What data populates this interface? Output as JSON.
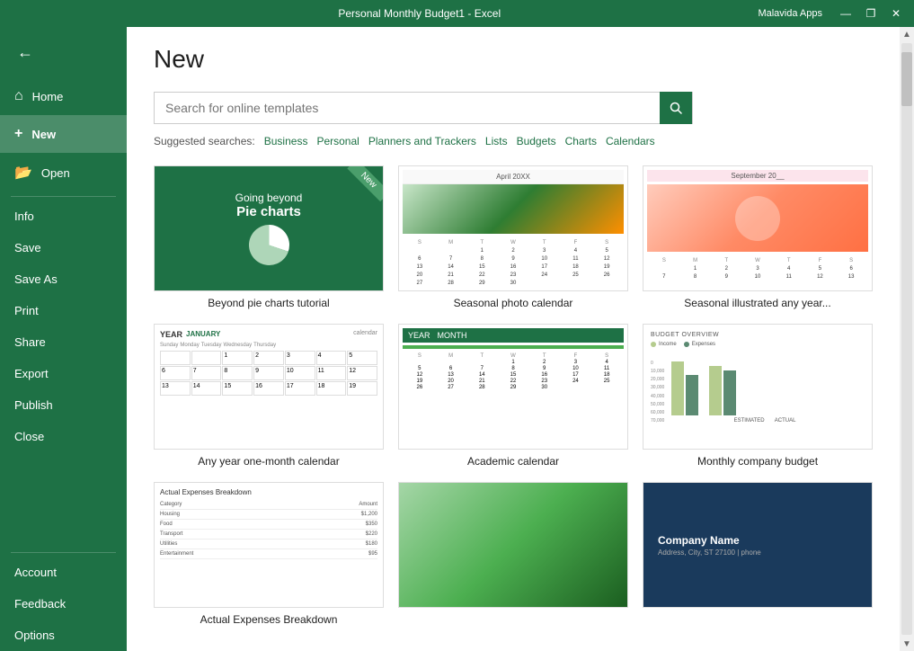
{
  "titlebar": {
    "title": "Personal Monthly Budget1  -  Excel",
    "app": "Malavida Apps",
    "minimize": "—",
    "maximize": "❐",
    "close": "✕"
  },
  "sidebar": {
    "back_icon": "←",
    "nav_items": [
      {
        "id": "home",
        "label": "Home",
        "icon": "⌂"
      },
      {
        "id": "new",
        "label": "New",
        "icon": "+"
      }
    ],
    "open_item": {
      "id": "open",
      "label": "Open",
      "icon": "📂"
    },
    "section_items": [
      {
        "id": "info",
        "label": "Info"
      },
      {
        "id": "save",
        "label": "Save"
      },
      {
        "id": "save-as",
        "label": "Save As"
      },
      {
        "id": "print",
        "label": "Print"
      },
      {
        "id": "share",
        "label": "Share"
      },
      {
        "id": "export",
        "label": "Export"
      },
      {
        "id": "publish",
        "label": "Publish"
      },
      {
        "id": "close",
        "label": "Close"
      }
    ],
    "bottom_items": [
      {
        "id": "account",
        "label": "Account"
      },
      {
        "id": "feedback",
        "label": "Feedback"
      },
      {
        "id": "options",
        "label": "Options"
      }
    ]
  },
  "main": {
    "title": "New",
    "search": {
      "placeholder": "Search for online templates",
      "button_icon": "🔍"
    },
    "suggested_label": "Suggested searches:",
    "suggested_tags": [
      "Business",
      "Personal",
      "Planners and Trackers",
      "Lists",
      "Budgets",
      "Charts",
      "Calendars"
    ],
    "templates": [
      {
        "id": "pie-charts-tutorial",
        "name": "Beyond pie charts tutorial",
        "type": "pie-charts",
        "is_new": true
      },
      {
        "id": "seasonal-photo-calendar",
        "name": "Seasonal photo calendar",
        "type": "photo-calendar"
      },
      {
        "id": "seasonal-illustrated",
        "name": "Seasonal illustrated any year...",
        "type": "illustrated-calendar"
      },
      {
        "id": "any-year-calendar",
        "name": "Any year one-month calendar",
        "type": "year-calendar"
      },
      {
        "id": "academic-calendar",
        "name": "Academic calendar",
        "type": "academic-calendar"
      },
      {
        "id": "monthly-company-budget",
        "name": "Monthly company budget",
        "type": "budget"
      },
      {
        "id": "actual-expenses",
        "name": "Actual Expenses Breakdown",
        "type": "expenses"
      },
      {
        "id": "green-abstract",
        "name": "",
        "type": "green-abstract"
      },
      {
        "id": "company-card",
        "name": "",
        "type": "company-card",
        "company_name": "Company Name",
        "company_sub": "Address, City, ST 27100  |  phone"
      }
    ],
    "bar_chart": {
      "y_ticks": [
        "70,000",
        "60,000",
        "50,000",
        "40,000",
        "30,000",
        "20,000",
        "10,000",
        "0"
      ],
      "groups": [
        {
          "label": "ESTIMATED",
          "bar1": {
            "color": "#b5cc8e",
            "height": 60
          },
          "bar2": {
            "color": "#5b8a72",
            "height": 45
          }
        },
        {
          "label": "ACTUAL",
          "bar1": {
            "color": "#b5cc8e",
            "height": 55
          },
          "bar2": {
            "color": "#5b8a72",
            "height": 50
          }
        }
      ],
      "legend": [
        {
          "label": "Income",
          "color": "#b5cc8e"
        },
        {
          "label": "Expenses",
          "color": "#5b8a72"
        }
      ]
    }
  }
}
